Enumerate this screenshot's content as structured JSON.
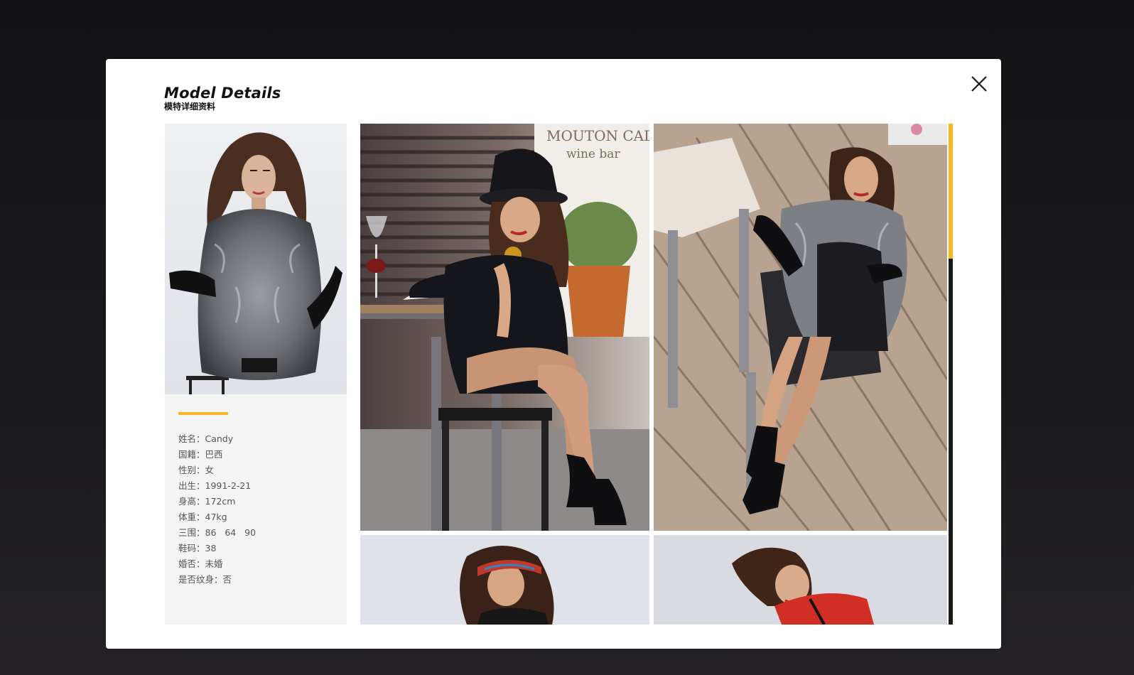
{
  "modal": {
    "title": "Model Details",
    "subtitle": "模特详细资料",
    "close_icon": "close-icon",
    "accent_color": "#f5b820"
  },
  "profile": {
    "photo_alt": "model portrait in grey fur vest",
    "details": [
      "姓名：Candy",
      "国籍：巴西",
      "性别：女",
      "出生：1991-2-21",
      "身高：172cm",
      "体重：47kg",
      "三围：86   64   90",
      "鞋码：38",
      "婚否：未婚",
      "是否纹身：否"
    ]
  },
  "gallery": {
    "photos": [
      {
        "alt": "model in black hat writing at cafe table",
        "sign_text_1": "MOUTON CADET",
        "sign_text_2": "wine bar"
      },
      {
        "alt": "model reclining on chair in fur vest on wooden deck"
      },
      {
        "alt": "model with colorful headband"
      },
      {
        "alt": "model in red leather jacket"
      }
    ]
  },
  "scrollbar": {
    "thumb_color": "#f5b820",
    "track_color": "#1a1a1a"
  }
}
